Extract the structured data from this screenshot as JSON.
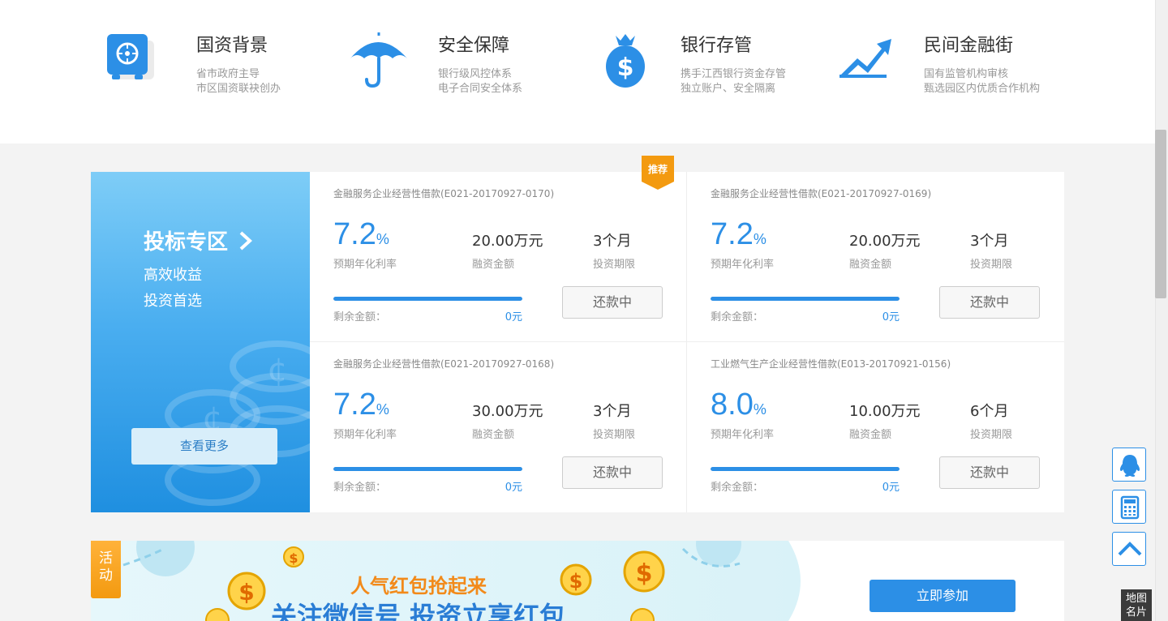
{
  "features": [
    {
      "title": "国资背景",
      "line1": "省市政府主导",
      "line2": "市区国资联袂创办",
      "icon": "safe-icon"
    },
    {
      "title": "安全保障",
      "line1": "银行级风控体系",
      "line2": "电子合同安全体系",
      "icon": "umbrella-icon"
    },
    {
      "title": "银行存管",
      "line1": "携手江西银行资金存管",
      "line2": "独立账户、安全隔离",
      "icon": "money-bag-icon"
    },
    {
      "title": "民间金融街",
      "line1": "国有监管机构审核",
      "line2": "甄选园区内优质合作机构",
      "icon": "trend-up-icon"
    }
  ],
  "promo": {
    "title": "投标专区",
    "sub1": "高效收益",
    "sub2": "投资首选",
    "more_label": "查看更多"
  },
  "loans": [
    {
      "title": "金融服务企业经营性借款(E021-20170927-0170)",
      "rate": "7.2",
      "rate_unit": "%",
      "rate_label": "预期年化利率",
      "amount": "20.00万元",
      "amount_label": "融资金额",
      "term": "3个月",
      "term_label": "投资期限",
      "progress": 1.0,
      "remain_label": "剩余金额：",
      "remain": "0元",
      "status": "还款中",
      "badge": "推荐"
    },
    {
      "title": "金融服务企业经营性借款(E021-20170927-0169)",
      "rate": "7.2",
      "rate_unit": "%",
      "rate_label": "预期年化利率",
      "amount": "20.00万元",
      "amount_label": "融资金额",
      "term": "3个月",
      "term_label": "投资期限",
      "progress": 1.0,
      "remain_label": "剩余金额：",
      "remain": "0元",
      "status": "还款中"
    },
    {
      "title": "金融服务企业经营性借款(E021-20170927-0168)",
      "rate": "7.2",
      "rate_unit": "%",
      "rate_label": "预期年化利率",
      "amount": "30.00万元",
      "amount_label": "融资金额",
      "term": "3个月",
      "term_label": "投资期限",
      "progress": 1.0,
      "remain_label": "剩余金额：",
      "remain": "0元",
      "status": "还款中"
    },
    {
      "title": "工业燃气生产企业经营性借款(E013-20170921-0156)",
      "rate": "8.0",
      "rate_unit": "%",
      "rate_label": "预期年化利率",
      "amount": "10.00万元",
      "amount_label": "融资金额",
      "term": "6个月",
      "term_label": "投资期限",
      "progress": 1.0,
      "remain_label": "剩余金额：",
      "remain": "0元",
      "status": "还款中"
    }
  ],
  "activity": {
    "tag": "活动",
    "line1": "人气红包抢起来",
    "line2": "关注微信号 投资立享红包",
    "join_label": "立即参加"
  },
  "side_tools": {
    "qq_icon": "qq-icon",
    "calculator_icon": "calculator-icon",
    "top_icon": "chevron-up-icon",
    "map_line1": "地图",
    "map_line2": "名片"
  },
  "colors": {
    "accent": "#2c8fe6",
    "orange": "#f39a10"
  }
}
